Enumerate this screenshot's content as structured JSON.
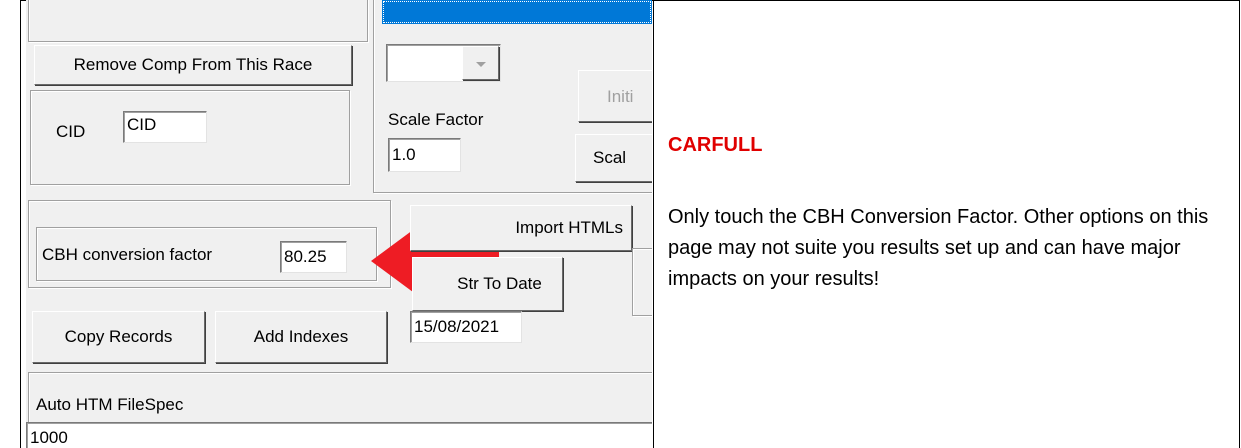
{
  "left_panel": {
    "remove_comp_button": "Remove Comp From This  Race",
    "cid_label": "CID",
    "cid_value": "CID",
    "scale_factor_label": "Scale Factor",
    "scale_factor_value": "1.0",
    "initial_button": "Initi",
    "scale_button": "Scal",
    "cbh_label": "CBH conversion factor",
    "cbh_value": "80.25",
    "import_htmls_button": "Import HTMLs",
    "str_to_date_button": "Str To Date",
    "date_value": "15/08/2021",
    "copy_records_button": "Copy Records",
    "add_indexes_button": "Add Indexes",
    "auto_htm_label": "Auto HTM FileSpec",
    "auto_htm_value": "1000"
  },
  "callout": {
    "heading": "CARFULL",
    "body": "Only touch the CBH Conversion Factor.  Other options on this page may not suite you results set up and can have major impacts on your results!"
  },
  "colors": {
    "heading": "#e00000",
    "arrow": "#ee1c24",
    "selection": "#0078d7"
  }
}
